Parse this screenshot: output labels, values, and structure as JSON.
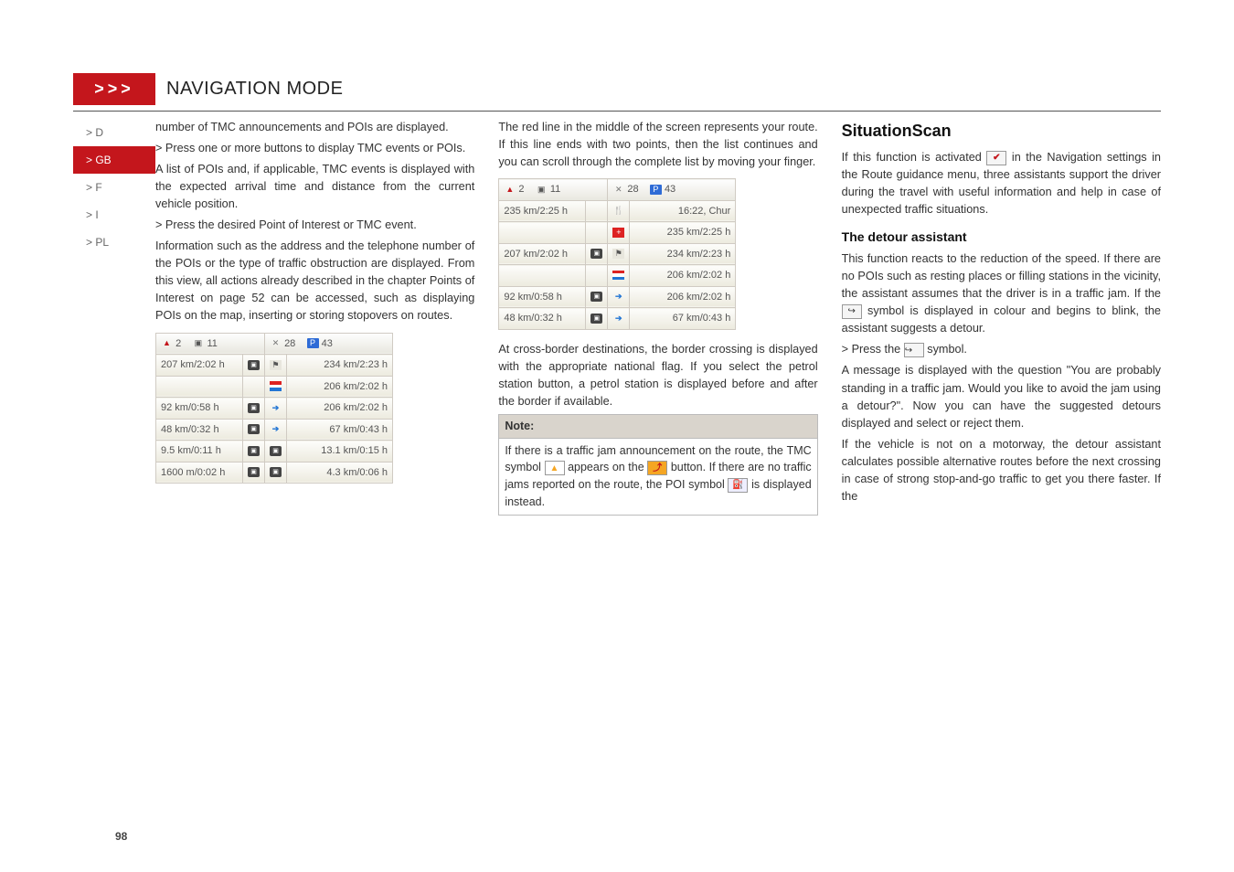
{
  "chevron": ">>>",
  "title": "NAVIGATION MODE",
  "langs": [
    "> D",
    "> GB",
    "> F",
    "> I",
    "> PL"
  ],
  "active_lang_index": 1,
  "col1": {
    "p1": "number of TMC announcements and POIs are displayed.",
    "b1": "> Press one or more buttons to display TMC events or POIs.",
    "p2": "A list of POIs and, if applicable, TMC events is displayed with the expected arrival time and distance from the current vehicle position.",
    "b2": "> Press the desired Point of Interest or TMC event.",
    "p3": "Information such as the address and the telephone number of the POIs or the type of traffic obstruction are displayed. From this view, all actions already described in the chapter Points of Interest on page 52 can be accessed, such as displaying POIs on the map, inserting or storing stopovers on routes."
  },
  "tabs": {
    "warn": "2",
    "poi": "11",
    "fork": "28",
    "park": "43"
  },
  "table1": [
    {
      "l": "207 km/2:02 h",
      "li": "speed",
      "ri": "flag",
      "r": "234 km/2:23 h"
    },
    {
      "l": "",
      "li": "",
      "ri": "lux",
      "r": "206 km/2:02 h"
    },
    {
      "l": "92 km/0:58 h",
      "li": "speed",
      "ri": "arr",
      "r": "206 km/2:02 h"
    },
    {
      "l": "48 km/0:32 h",
      "li": "speed",
      "ri": "arr",
      "r": "67 km/0:43 h"
    },
    {
      "l": "9.5 km/0:11 h",
      "li": "speed",
      "ri": "speed",
      "r": "13.1 km/0:15 h"
    },
    {
      "l": "1600 m/0:02 h",
      "li": "speed",
      "ri": "speed",
      "r": "4.3 km/0:06 h"
    }
  ],
  "col2": {
    "p1": "The red line in the middle of the screen represents your route. If this line ends with two points, then the list continues and you can scroll through the complete list by moving your finger."
  },
  "table2": [
    {
      "l": "235 km/2:25 h",
      "li": "",
      "ri": "rest",
      "r": "16:22, Chur"
    },
    {
      "l": "",
      "li": "",
      "ri": "swiss",
      "r": "235 km/2:25 h"
    },
    {
      "l": "207 km/2:02 h",
      "li": "speed",
      "ri": "flag",
      "r": "234 km/2:23 h"
    },
    {
      "l": "",
      "li": "",
      "ri": "lux",
      "r": "206 km/2:02 h"
    },
    {
      "l": "92 km/0:58 h",
      "li": "speed",
      "ri": "arr",
      "r": "206 km/2:02 h"
    },
    {
      "l": "48 km/0:32 h",
      "li": "speed",
      "ri": "arr",
      "r": "67 km/0:43 h"
    }
  ],
  "col2b": {
    "p2": "At cross-border destinations, the border crossing is displayed with the appropriate national flag. If you select the petrol station button, a petrol station is displayed before and after the border if available."
  },
  "note": {
    "title": "Note:",
    "seg1": "If there is a traffic jam announcement on the route, the TMC symbol ",
    "seg2": " appears on the ",
    "seg3": " button. If there are no traffic jams reported on the route, the POI symbol ",
    "seg4": " is displayed instead."
  },
  "col3": {
    "h2": "SituationScan",
    "p1a": "If this function is activated ",
    "p1b": " in the Navigation settings in the Route guidance menu, three assistants support the driver during the travel with useful information and help in case of unexpected traffic situations.",
    "h3": "The detour assistant",
    "p2a": "This function reacts to the reduction of the speed. If there are no POIs such as resting places or filling stations in the vicinity, the assistant assumes that the driver is in a traffic jam. If the ",
    "p2b": " symbol is displayed in colour and begins to blink, the assistant suggests a detour.",
    "b1a": "> Press the ",
    "b1b": " symbol.",
    "p3": "A message is displayed with the question \"You are probably standing in a traffic jam. Would you like to avoid the jam using a detour?\". Now you can have the suggested detours displayed and select or reject them.",
    "p4": "If the vehicle is not on a motorway, the detour assistant calculates possible alternative routes before the next crossing in case of strong stop-and-go traffic to get you there faster. If the"
  },
  "page_number": "98"
}
